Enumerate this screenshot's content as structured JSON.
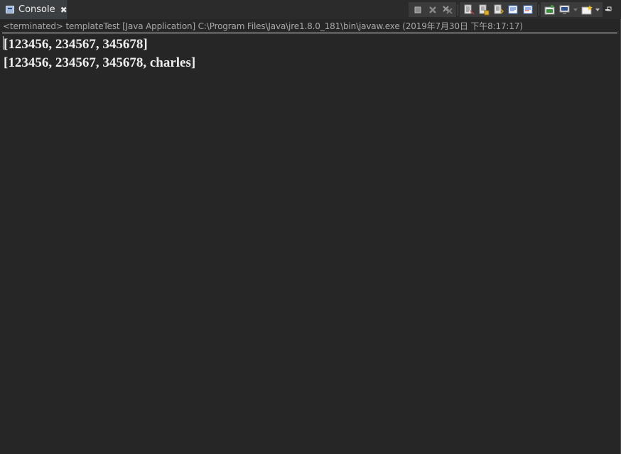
{
  "tab": {
    "label": "Console",
    "close_label": "✖",
    "icon": "console-icon"
  },
  "toolbar": {
    "buttons": [
      {
        "name": "terminate-button",
        "icon": "stop-icon"
      },
      {
        "name": "remove-launch-button",
        "icon": "remove-icon"
      },
      {
        "name": "remove-all-terminated-button",
        "icon": "remove-all-icon"
      },
      {
        "name": "clear-console-button",
        "icon": "clear-console-icon"
      },
      {
        "name": "scroll-lock-button",
        "icon": "scroll-lock-icon"
      },
      {
        "name": "word-wrap-button",
        "icon": "word-wrap-icon"
      },
      {
        "name": "show-stdout-button",
        "icon": "show-stdout-icon"
      },
      {
        "name": "show-stderr-button",
        "icon": "show-stderr-icon"
      },
      {
        "name": "pin-console-button",
        "icon": "pin-console-icon"
      },
      {
        "name": "display-console-button",
        "icon": "display-console-icon"
      },
      {
        "name": "open-console-button",
        "icon": "open-console-icon"
      },
      {
        "name": "minimize-button",
        "icon": "minimize-icon"
      }
    ]
  },
  "status": {
    "text": "<terminated> templateTest [Java Application] C:\\Program Files\\Java\\jre1.8.0_181\\bin\\javaw.exe (2019年7月30日 下午8:17:17)"
  },
  "output": {
    "lines": [
      "[123456, 234567, 345678]",
      "[123456, 234567, 345678, charles]"
    ]
  }
}
